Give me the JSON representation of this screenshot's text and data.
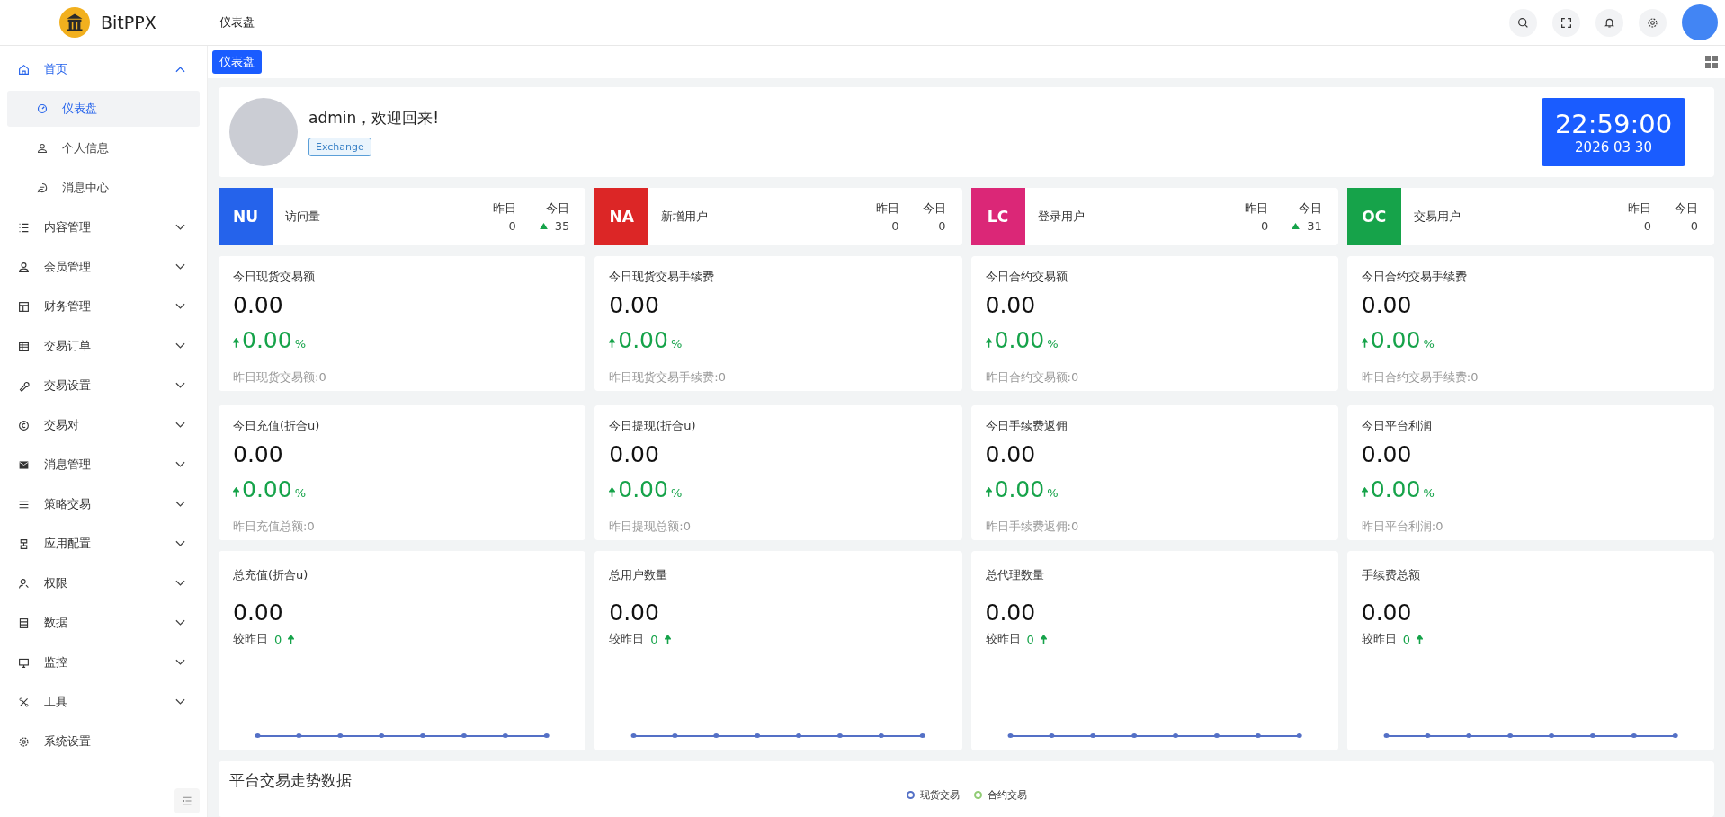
{
  "header": {
    "logo_text": "BitPPX",
    "breadcrumb": "仪表盘"
  },
  "tabs": [
    {
      "label": "仪表盘",
      "selected": true
    }
  ],
  "sidebar": {
    "items": [
      {
        "label": "首页",
        "expanded": true,
        "children": [
          {
            "label": "仪表盘",
            "selected": true
          },
          {
            "label": "个人信息",
            "selected": false
          },
          {
            "label": "消息中心",
            "selected": false
          }
        ]
      },
      {
        "label": "内容管理",
        "expanded": false
      },
      {
        "label": "会员管理",
        "expanded": false
      },
      {
        "label": "财务管理",
        "expanded": false
      },
      {
        "label": "交易订单",
        "expanded": false
      },
      {
        "label": "交易设置",
        "expanded": false
      },
      {
        "label": "交易对",
        "expanded": false
      },
      {
        "label": "消息管理",
        "expanded": false
      },
      {
        "label": "策略交易",
        "expanded": false
      },
      {
        "label": "应用配置",
        "expanded": false
      },
      {
        "label": "权限",
        "expanded": false
      },
      {
        "label": "数据",
        "expanded": false
      },
      {
        "label": "监控",
        "expanded": false
      },
      {
        "label": "工具",
        "expanded": false
      },
      {
        "label": "系统设置"
      }
    ]
  },
  "welcome": {
    "greeting": "admin，欢迎回来!",
    "tag": "Exchange",
    "time": "22:59:00",
    "date": "2026 03 30"
  },
  "stat_cards": [
    {
      "badge": "NU",
      "color": "#2563eb",
      "title": "访问量",
      "yesterday_label": "昨日",
      "yesterday": "0",
      "today_label": "今日",
      "today": "35",
      "rising": true
    },
    {
      "badge": "NA",
      "color": "#dc2626",
      "title": "新增用户",
      "yesterday_label": "昨日",
      "yesterday": "0",
      "today_label": "今日",
      "today": "0",
      "rising": false
    },
    {
      "badge": "LC",
      "color": "#db2777",
      "title": "登录用户",
      "yesterday_label": "昨日",
      "yesterday": "0",
      "today_label": "今日",
      "today": "31",
      "rising": true
    },
    {
      "badge": "OC",
      "color": "#16a34a",
      "title": "交易用户",
      "yesterday_label": "昨日",
      "yesterday": "0",
      "today_label": "今日",
      "today": "0",
      "rising": false
    }
  ],
  "metrics": [
    {
      "title": "今日现货交易额",
      "value": "0.00",
      "change": "0.00",
      "unit": "%",
      "footer": "昨日现货交易额:0"
    },
    {
      "title": "今日现货交易手续费",
      "value": "0.00",
      "change": "0.00",
      "unit": "%",
      "footer": "昨日现货交易手续费:0"
    },
    {
      "title": "今日合约交易额",
      "value": "0.00",
      "change": "0.00",
      "unit": "%",
      "footer": "昨日合约交易额:0"
    },
    {
      "title": "今日合约交易手续费",
      "value": "0.00",
      "change": "0.00",
      "unit": "%",
      "footer": "昨日合约交易手续费:0"
    },
    {
      "title": "今日充值(折合u)",
      "value": "0.00",
      "change": "0.00",
      "unit": "%",
      "footer": "昨日充值总额:0"
    },
    {
      "title": "今日提现(折合u)",
      "value": "0.00",
      "change": "0.00",
      "unit": "%",
      "footer": "昨日提现总额:0"
    },
    {
      "title": "今日手续费返佣",
      "value": "0.00",
      "change": "0.00",
      "unit": "%",
      "footer": "昨日手续费返佣:0"
    },
    {
      "title": "今日平台利润",
      "value": "0.00",
      "change": "0.00",
      "unit": "%",
      "footer": "昨日平台利润:0"
    }
  ],
  "totals": [
    {
      "title": "总充值(折合u)",
      "value": "0.00",
      "compare_label": "较昨日",
      "compare_value": "0"
    },
    {
      "title": "总用户数量",
      "value": "0.00",
      "compare_label": "较昨日",
      "compare_value": "0"
    },
    {
      "title": "总代理数量",
      "value": "0.00",
      "compare_label": "较昨日",
      "compare_value": "0"
    },
    {
      "title": "手续费总额",
      "value": "0.00",
      "compare_label": "较昨日",
      "compare_value": "0"
    }
  ],
  "trend_panel": {
    "title": "平台交易走势数据",
    "legend": [
      {
        "label": "现货交易",
        "color": "#5470c6"
      },
      {
        "label": "合约交易",
        "color": "#91cc75"
      }
    ]
  }
}
